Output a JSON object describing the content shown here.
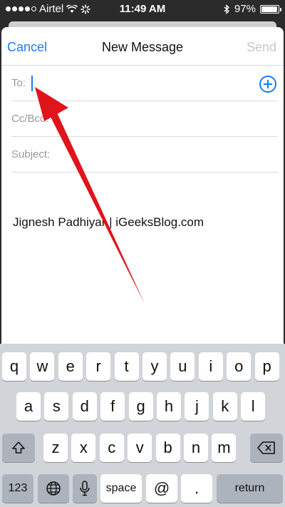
{
  "status_bar": {
    "carrier": "Airtel",
    "time": "11:49 AM",
    "battery_percent": "97%",
    "battery_level": 0.97
  },
  "nav": {
    "cancel_label": "Cancel",
    "title": "New Message",
    "send_label": "Send"
  },
  "fields": {
    "to_label": "To:",
    "cc_label": "Cc/Bcc:",
    "subject_label": "Subject:"
  },
  "body": {
    "signature": "Jignesh Padhiyar | iGeeksBlog.com"
  },
  "keyboard": {
    "row1": [
      "q",
      "w",
      "e",
      "r",
      "t",
      "y",
      "u",
      "i",
      "o",
      "p"
    ],
    "row2": [
      "a",
      "s",
      "d",
      "f",
      "g",
      "h",
      "j",
      "k",
      "l"
    ],
    "row3": [
      "z",
      "x",
      "c",
      "v",
      "b",
      "n",
      "m"
    ],
    "numbers_label": "123",
    "space_label": "space",
    "at_label": "@",
    "dot_label": ".",
    "return_label": "return"
  },
  "colors": {
    "accent": "#1a7cf2",
    "arrow": "#e0141b"
  },
  "icons": {
    "wifi": "wifi-icon",
    "bluetooth": "bluetooth-icon",
    "add_contact": "add-contact-icon",
    "shift": "shift-icon",
    "backspace": "backspace-icon",
    "globe": "globe-icon",
    "microphone": "microphone-icon"
  }
}
